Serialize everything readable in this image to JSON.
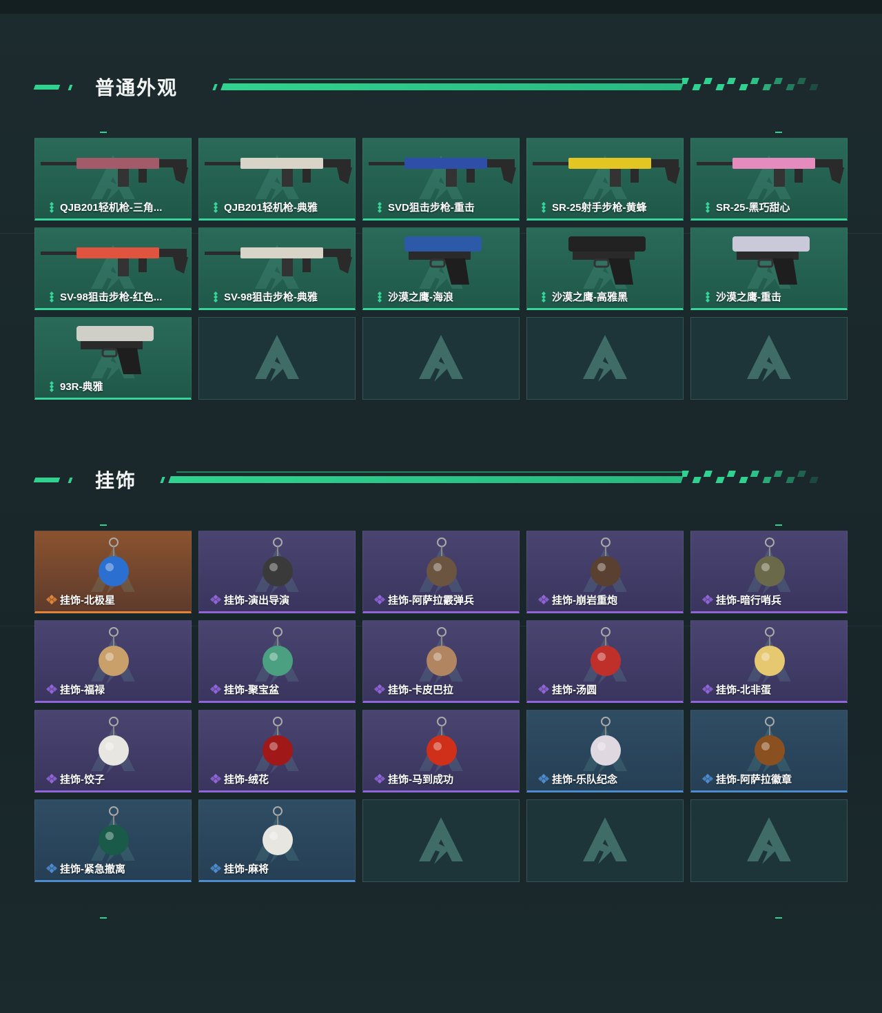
{
  "sections": [
    {
      "title": "普通外观",
      "items": [
        {
          "label": "QJB201轻机枪-三角...",
          "rarity": "green",
          "icon": "lmg-icon"
        },
        {
          "label": "QJB201轻机枪-典雅",
          "rarity": "green",
          "icon": "lmg-icon"
        },
        {
          "label": "SVD狙击步枪-重击",
          "rarity": "green",
          "icon": "sniper-rifle-icon"
        },
        {
          "label": "SR-25射手步枪-黄蜂",
          "rarity": "green",
          "icon": "marksman-rifle-icon"
        },
        {
          "label": "SR-25-黑巧甜心",
          "rarity": "green",
          "icon": "marksman-rifle-icon"
        },
        {
          "label": "SV-98狙击步枪-红色...",
          "rarity": "green",
          "icon": "sniper-rifle-icon"
        },
        {
          "label": "SV-98狙击步枪-典雅",
          "rarity": "green",
          "icon": "sniper-rifle-icon"
        },
        {
          "label": "沙漠之鹰-海浪",
          "rarity": "green",
          "icon": "pistol-icon"
        },
        {
          "label": "沙漠之鹰-高雅黑",
          "rarity": "green",
          "icon": "pistol-icon"
        },
        {
          "label": "沙漠之鹰-重击",
          "rarity": "green",
          "icon": "pistol-icon"
        },
        {
          "label": "93R-典雅",
          "rarity": "green",
          "icon": "pistol-icon"
        }
      ]
    },
    {
      "title": "挂饰",
      "items": [
        {
          "label": "挂饰-北极星",
          "rarity": "orange",
          "icon": "charm-icon"
        },
        {
          "label": "挂饰-演出导演",
          "rarity": "purple",
          "icon": "charm-icon"
        },
        {
          "label": "挂饰-阿萨拉霰弹兵",
          "rarity": "purple",
          "icon": "charm-icon"
        },
        {
          "label": "挂饰-崩岩重炮",
          "rarity": "purple",
          "icon": "charm-icon"
        },
        {
          "label": "挂饰-暗行哨兵",
          "rarity": "purple",
          "icon": "charm-icon"
        },
        {
          "label": "挂饰-福禄",
          "rarity": "purple",
          "icon": "charm-icon"
        },
        {
          "label": "挂饰-聚宝盆",
          "rarity": "purple",
          "icon": "charm-icon"
        },
        {
          "label": "挂饰-卡皮巴拉",
          "rarity": "purple",
          "icon": "charm-icon"
        },
        {
          "label": "挂饰-汤圆",
          "rarity": "purple",
          "icon": "charm-icon"
        },
        {
          "label": "挂饰-北非蛋",
          "rarity": "purple",
          "icon": "charm-icon"
        },
        {
          "label": "挂饰-饺子",
          "rarity": "purple",
          "icon": "charm-icon"
        },
        {
          "label": "挂饰-绒花",
          "rarity": "purple",
          "icon": "charm-icon"
        },
        {
          "label": "挂饰-马到成功",
          "rarity": "purple",
          "icon": "charm-icon"
        },
        {
          "label": "挂饰-乐队纪念",
          "rarity": "blue",
          "icon": "charm-icon"
        },
        {
          "label": "挂饰-阿萨拉徽章",
          "rarity": "blue",
          "icon": "charm-icon"
        },
        {
          "label": "挂饰-紧急撤离",
          "rarity": "blue",
          "icon": "charm-icon"
        },
        {
          "label": "挂饰-麻将",
          "rarity": "blue",
          "icon": "charm-icon"
        }
      ]
    }
  ],
  "colors": {
    "accent": "#2fd38f",
    "green": "#37d59a",
    "orange": "#e0843c",
    "purple": "#9065d8",
    "blue": "#4d8dcf"
  }
}
